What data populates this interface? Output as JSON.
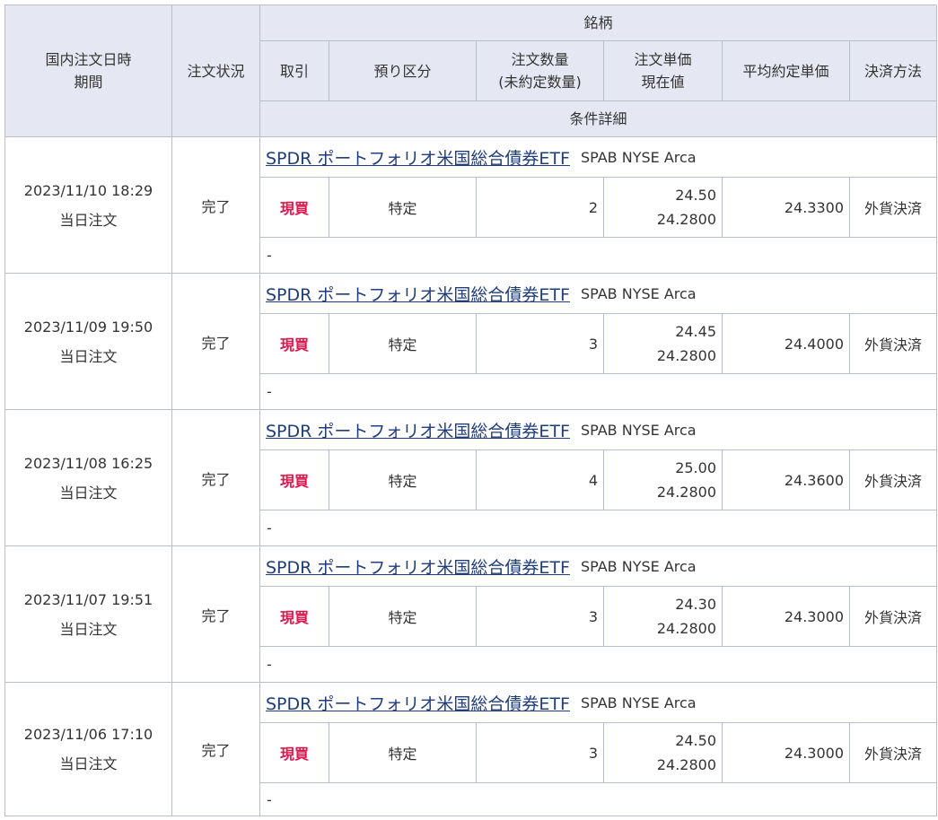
{
  "header": {
    "datetime_line1": "国内注文日時",
    "datetime_line2": "期間",
    "status": "注文状況",
    "symbol": "銘柄",
    "trade": "取引",
    "account_type": "預り区分",
    "qty_line1": "注文数量",
    "qty_line2": "(未約定数量)",
    "price_line1": "注文単価",
    "price_line2": "現在値",
    "avg_price": "平均約定単価",
    "settlement": "決済方法",
    "conditions": "条件詳細"
  },
  "orders": [
    {
      "date": "2023/11/10 18:29",
      "period": "当日注文",
      "status": "完了",
      "name": "SPDR ポートフォリオ米国総合債券ETF",
      "ticker": "SPAB NYSE Arca",
      "trade": "現買",
      "account": "特定",
      "qty": "2",
      "order_price": "24.50",
      "current_price": "24.2800",
      "avg_price": "24.3300",
      "settlement": "外貨決済",
      "detail": "-"
    },
    {
      "date": "2023/11/09 19:50",
      "period": "当日注文",
      "status": "完了",
      "name": "SPDR ポートフォリオ米国総合債券ETF",
      "ticker": "SPAB NYSE Arca",
      "trade": "現買",
      "account": "特定",
      "qty": "3",
      "order_price": "24.45",
      "current_price": "24.2800",
      "avg_price": "24.4000",
      "settlement": "外貨決済",
      "detail": "-"
    },
    {
      "date": "2023/11/08 16:25",
      "period": "当日注文",
      "status": "完了",
      "name": "SPDR ポートフォリオ米国総合債券ETF",
      "ticker": "SPAB NYSE Arca",
      "trade": "現買",
      "account": "特定",
      "qty": "4",
      "order_price": "25.00",
      "current_price": "24.2800",
      "avg_price": "24.3600",
      "settlement": "外貨決済",
      "detail": "-"
    },
    {
      "date": "2023/11/07 19:51",
      "period": "当日注文",
      "status": "完了",
      "name": "SPDR ポートフォリオ米国総合債券ETF",
      "ticker": "SPAB NYSE Arca",
      "trade": "現買",
      "account": "特定",
      "qty": "3",
      "order_price": "24.30",
      "current_price": "24.2800",
      "avg_price": "24.3000",
      "settlement": "外貨決済",
      "detail": "-"
    },
    {
      "date": "2023/11/06 17:10",
      "period": "当日注文",
      "status": "完了",
      "name": "SPDR ポートフォリオ米国総合債券ETF",
      "ticker": "SPAB NYSE Arca",
      "trade": "現買",
      "account": "特定",
      "qty": "3",
      "order_price": "24.50",
      "current_price": "24.2800",
      "avg_price": "24.3000",
      "settlement": "外貨決済",
      "detail": "-"
    }
  ]
}
